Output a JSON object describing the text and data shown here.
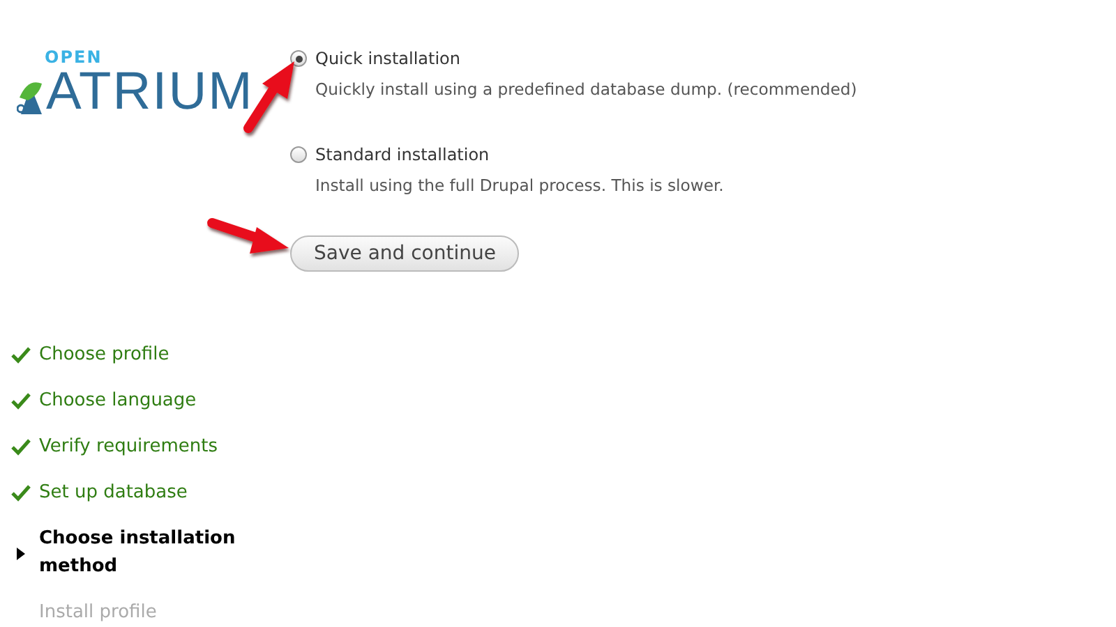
{
  "logo": {
    "small": "OPEN",
    "large": "ATRIUM"
  },
  "options": [
    {
      "label": "Quick installation",
      "description": "Quickly install using a predefined database dump. (recommended)",
      "selected": true
    },
    {
      "label": "Standard installation",
      "description": "Install using the full Drupal process. This is slower.",
      "selected": false
    }
  ],
  "submit": "Save and continue",
  "steps": [
    {
      "label": "Choose profile",
      "kind": "done"
    },
    {
      "label": "Choose language",
      "kind": "done"
    },
    {
      "label": "Verify requirements",
      "kind": "done"
    },
    {
      "label": "Set up database",
      "kind": "done"
    },
    {
      "label": "Choose installation method",
      "kind": "active"
    },
    {
      "label": "Install profile",
      "kind": "pending"
    }
  ]
}
